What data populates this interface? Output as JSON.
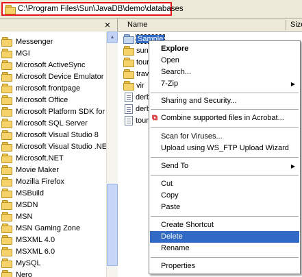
{
  "address": {
    "path": "C:\\Program Files\\Sun\\JavaDB\\demo\\databases",
    "highlight_color": "#e8141a"
  },
  "tree": {
    "close_glyph": "×",
    "items": [
      {
        "label": "Messenger"
      },
      {
        "label": "MGI"
      },
      {
        "label": "Microsoft ActiveSync"
      },
      {
        "label": "Microsoft Device Emulator"
      },
      {
        "label": "microsoft frontpage"
      },
      {
        "label": "Microsoft Office"
      },
      {
        "label": "Microsoft Platform SDK for W"
      },
      {
        "label": "Microsoft SQL Server"
      },
      {
        "label": "Microsoft Visual Studio 8"
      },
      {
        "label": "Microsoft Visual Studio .NET"
      },
      {
        "label": "Microsoft.NET"
      },
      {
        "label": "Movie Maker"
      },
      {
        "label": "Mozilla Firefox"
      },
      {
        "label": "MSBuild"
      },
      {
        "label": "MSDN"
      },
      {
        "label": "MSN"
      },
      {
        "label": "MSN Gaming Zone"
      },
      {
        "label": "MSXML 4.0"
      },
      {
        "label": "MSXML 6.0"
      },
      {
        "label": "MySQL"
      },
      {
        "label": "Nero"
      }
    ]
  },
  "list": {
    "columns": {
      "name": "Name",
      "size": "Size"
    },
    "files": [
      {
        "label": "Sample",
        "icon": "folder-icon",
        "selected": true
      },
      {
        "label": "sun-",
        "icon": "folder-icon"
      },
      {
        "label": "tour",
        "icon": "folder-icon"
      },
      {
        "label": "trav",
        "icon": "folder-icon"
      },
      {
        "label": "vir",
        "icon": "folder-icon"
      },
      {
        "label": "derb",
        "icon": "file-icon"
      },
      {
        "label": "derb",
        "icon": "file-icon"
      },
      {
        "label": "tour",
        "icon": "file-icon"
      }
    ]
  },
  "context_menu": {
    "explore": "Explore",
    "open": "Open",
    "search": "Search...",
    "seven_zip": "7-Zip",
    "sharing": "Sharing and Security...",
    "combine": "Combine supported files in Acrobat...",
    "scan": "Scan for Viruses...",
    "upload": "Upload using WS_FTP Upload Wizard",
    "send_to": "Send To",
    "cut": "Cut",
    "copy": "Copy",
    "paste": "Paste",
    "create_shortcut": "Create Shortcut",
    "delete": "Delete",
    "rename": "Rename",
    "properties": "Properties",
    "submenu_arrow": "▶",
    "highlight_color": "#316ac5"
  }
}
